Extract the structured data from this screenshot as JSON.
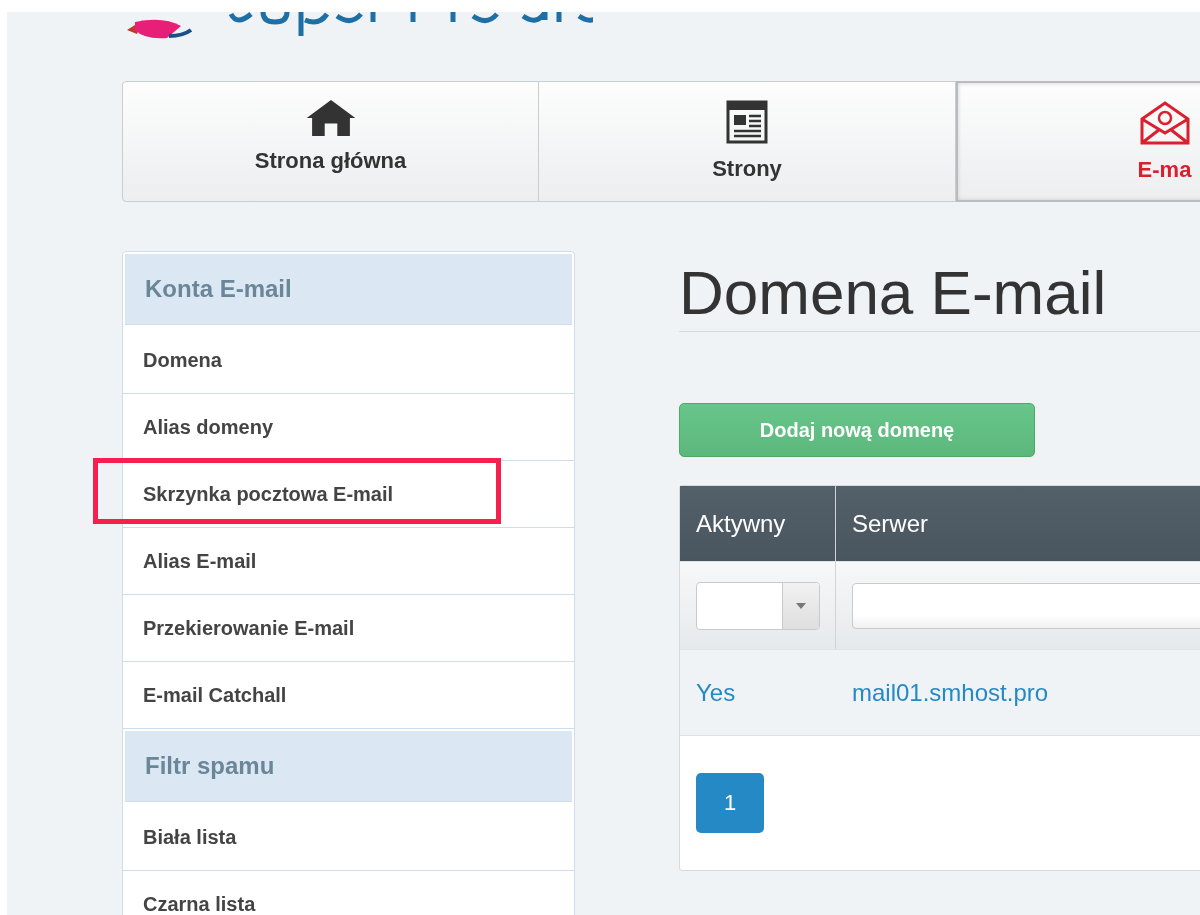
{
  "nav_tabs": [
    {
      "label": "Strona główna",
      "kind": "home",
      "selected": false
    },
    {
      "label": "Strony",
      "kind": "page",
      "selected": false
    },
    {
      "label": "E-ma",
      "kind": "mail",
      "selected": true
    }
  ],
  "sidebar": {
    "sections": [
      {
        "title": "Konta E-mail",
        "items": [
          {
            "label": "Domena",
            "highlighted": false
          },
          {
            "label": "Alias domeny",
            "highlighted": false
          },
          {
            "label": "Skrzynka pocztowa E-mail",
            "highlighted": true
          },
          {
            "label": "Alias E-mail",
            "highlighted": false
          },
          {
            "label": "Przekierowanie E-mail",
            "highlighted": false
          },
          {
            "label": "E-mail Catchall",
            "highlighted": false
          }
        ]
      },
      {
        "title": "Filtr spamu",
        "items": [
          {
            "label": "Biała lista",
            "highlighted": false
          },
          {
            "label": "Czarna lista",
            "highlighted": false
          }
        ]
      }
    ]
  },
  "page_title": "Domena E-mail",
  "add_button": "Dodaj nową domenę",
  "table": {
    "columns": [
      "Aktywny",
      "Serwer"
    ],
    "rows": [
      [
        "Yes",
        "mail01.smhost.pro"
      ]
    ]
  },
  "pagination": [
    {
      "label": "1",
      "selected": true
    }
  ]
}
